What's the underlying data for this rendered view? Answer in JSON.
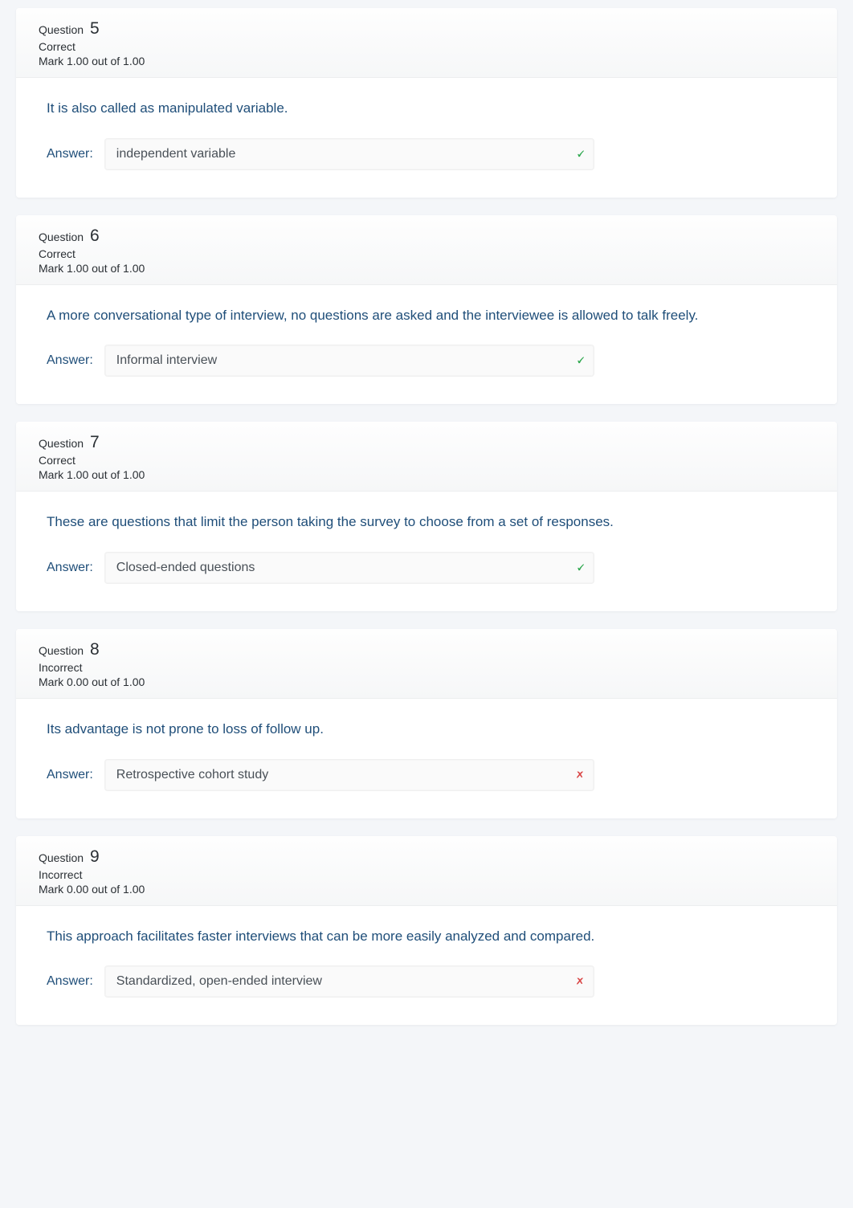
{
  "questions": [
    {
      "number": "5",
      "state": "Correct",
      "mark": "Mark 1.00 out of 1.00",
      "prompt": "It is also called as manipulated variable.",
      "answer_label": "Answer:",
      "answer_value": "independent variable",
      "result": "correct"
    },
    {
      "number": "6",
      "state": "Correct",
      "mark": "Mark 1.00 out of 1.00",
      "prompt": "A more conversational type of interview, no questions are asked and the interviewee is allowed to talk freely.",
      "answer_label": "Answer:",
      "answer_value": "Informal interview",
      "result": "correct"
    },
    {
      "number": "7",
      "state": "Correct",
      "mark": "Mark 1.00 out of 1.00",
      "prompt": "These are questions that limit the person taking the survey to choose from a set of responses.",
      "answer_label": "Answer:",
      "answer_value": "Closed-ended questions",
      "result": "correct"
    },
    {
      "number": "8",
      "state": "Incorrect",
      "mark": "Mark 0.00 out of 1.00",
      "prompt": "Its advantage is not prone to loss of follow up.",
      "answer_label": "Answer:",
      "answer_value": "Retrospective cohort study",
      "result": "incorrect"
    },
    {
      "number": "9",
      "state": "Incorrect",
      "mark": "Mark 0.00 out of 1.00",
      "prompt": "This approach facilitates faster interviews that can be more easily analyzed and compared.",
      "answer_label": "Answer:",
      "answer_value": "Standardized, open-ended interview",
      "result": "incorrect"
    }
  ],
  "labels": {
    "question_word": "Question"
  },
  "icons": {
    "correct": "🗸",
    "incorrect": "🗴"
  }
}
